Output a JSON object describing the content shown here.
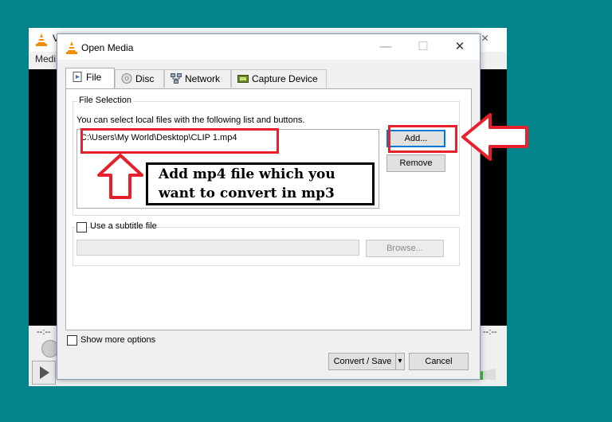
{
  "main_window": {
    "title": "V",
    "menu": "Medi",
    "close_icon": "×",
    "time_left": "--:--",
    "time_right": "--:--"
  },
  "dialog": {
    "title": "Open Media",
    "minimize": "—",
    "maximize": "☐",
    "close": "✕"
  },
  "tabs": [
    {
      "label": "File",
      "icon": "file-icon"
    },
    {
      "label": "Disc",
      "icon": "disc-icon"
    },
    {
      "label": "Network",
      "icon": "network-icon"
    },
    {
      "label": "Capture Device",
      "icon": "capture-device-icon"
    }
  ],
  "file_selection": {
    "legend": "File Selection",
    "description": "You can select local files with the following list and buttons.",
    "files": [
      "C:\\Users\\My World\\Desktop\\CLIP 1.mp4"
    ],
    "add_label": "Add...",
    "remove_label": "Remove"
  },
  "subtitle": {
    "checkbox_label": "Use a subtitle file",
    "checked": false,
    "path_value": "",
    "browse_label": "Browse..."
  },
  "show_more_options": {
    "label": "Show more options",
    "checked": false
  },
  "footer": {
    "convert_label": "Convert / Save",
    "dropdown_icon": "▾",
    "cancel_label": "Cancel"
  },
  "annotation": {
    "text_line1": "Add mp4 file which you",
    "text_line2": "want to convert in mp3",
    "accent_color": "#e8202b"
  }
}
